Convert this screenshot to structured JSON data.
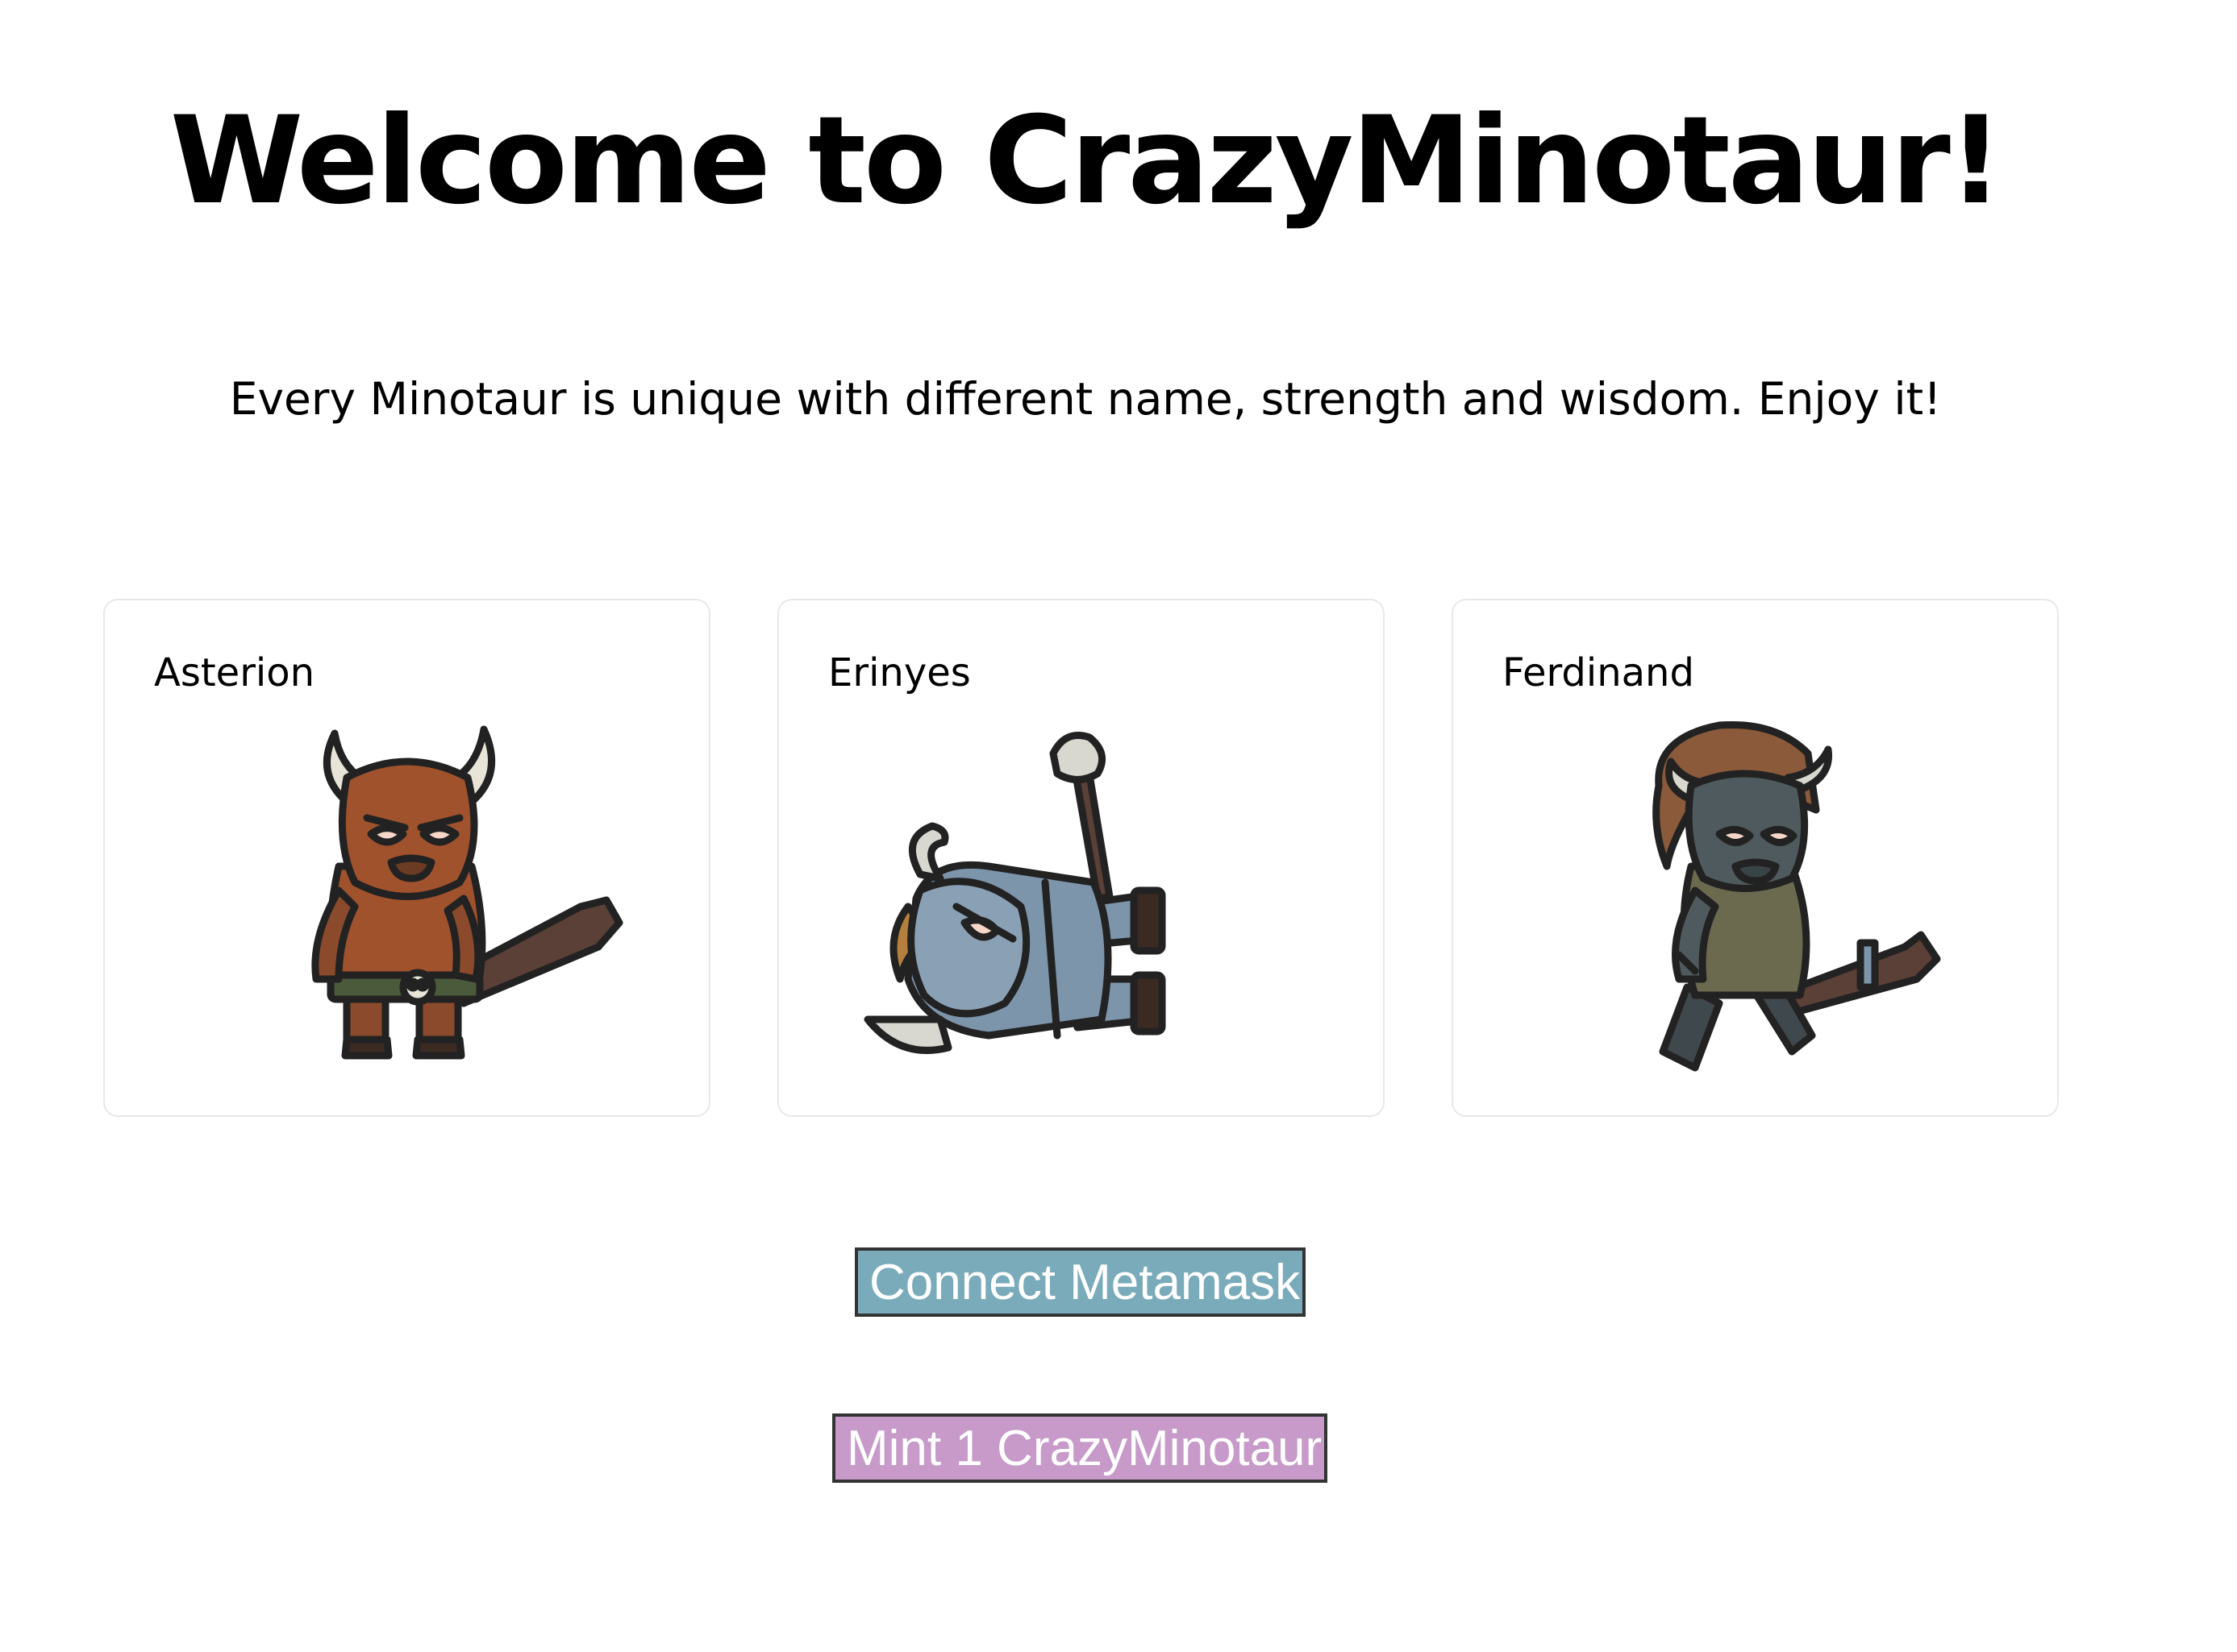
{
  "page": {
    "title": "Welcome to CrazyMinotaur!",
    "subtitle": "Every Minotaur is unique with different name, strength and wisdom. Enjoy it!"
  },
  "cards": [
    {
      "name": "Asterion",
      "pose": "standing-with-club",
      "color": "#a0522d"
    },
    {
      "name": "Erinyes",
      "pose": "fallen-knocked-down",
      "color": "#7d95ab"
    },
    {
      "name": "Ferdinand",
      "pose": "walking-with-club",
      "color": "#4f5a5e"
    }
  ],
  "buttons": {
    "connect_label": "Connect Metamask",
    "connect_color": "#7aabba",
    "mint_label": "Mint 1 CrazyMinotaur",
    "mint_color": "#c79ac9"
  }
}
